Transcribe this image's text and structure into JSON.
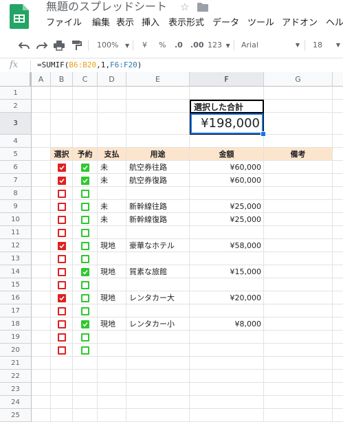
{
  "app": {
    "doc_title": "無題のスプレッドシート",
    "menu": [
      "ファイル",
      "編集",
      "表示",
      "挿入",
      "表示形式",
      "データ",
      "ツール",
      "アドオン",
      "ヘルプ"
    ]
  },
  "toolbar": {
    "zoom": "100%",
    "currency": "¥",
    "percent": "%",
    "dec_decrease": ".0",
    "dec_increase": ".00",
    "more_formats": "123",
    "font": "Arial",
    "font_size": "18"
  },
  "formula_bar": {
    "fx": "fx",
    "prefix": "=SUMIF(",
    "range1": "B6:B20",
    "mid": ",1,",
    "range2": "F6:F20",
    "suffix": ")"
  },
  "columns": [
    "A",
    "B",
    "C",
    "D",
    "E",
    "F",
    "G"
  ],
  "selected_column": "F",
  "selected_row": 3,
  "summary": {
    "label": "選択した合計",
    "value": "¥198,000"
  },
  "table_header": {
    "select": "選択",
    "reserve": "予約",
    "payment": "支払",
    "purpose": "用途",
    "amount": "金額",
    "note": "備考"
  },
  "rows": [
    {
      "row": 6,
      "select": true,
      "reserve": true,
      "payment": "未",
      "purpose": "航空券往路",
      "amount": "¥60,000"
    },
    {
      "row": 7,
      "select": true,
      "reserve": true,
      "payment": "未",
      "purpose": "航空券復路",
      "amount": "¥60,000"
    },
    {
      "row": 8,
      "select": false,
      "reserve": false,
      "payment": "",
      "purpose": "",
      "amount": ""
    },
    {
      "row": 9,
      "select": false,
      "reserve": false,
      "payment": "未",
      "purpose": "新幹線往路",
      "amount": "¥25,000"
    },
    {
      "row": 10,
      "select": false,
      "reserve": false,
      "payment": "未",
      "purpose": "新幹線復路",
      "amount": "¥25,000"
    },
    {
      "row": 11,
      "select": false,
      "reserve": false,
      "payment": "",
      "purpose": "",
      "amount": ""
    },
    {
      "row": 12,
      "select": true,
      "reserve": false,
      "payment": "現地",
      "purpose": "豪華なホテル",
      "amount": "¥58,000"
    },
    {
      "row": 13,
      "select": false,
      "reserve": false,
      "payment": "",
      "purpose": "",
      "amount": ""
    },
    {
      "row": 14,
      "select": false,
      "reserve": true,
      "payment": "現地",
      "purpose": "質素な旅館",
      "amount": "¥15,000"
    },
    {
      "row": 15,
      "select": false,
      "reserve": false,
      "payment": "",
      "purpose": "",
      "amount": ""
    },
    {
      "row": 16,
      "select": true,
      "reserve": false,
      "payment": "現地",
      "purpose": "レンタカー大",
      "amount": "¥20,000"
    },
    {
      "row": 17,
      "select": false,
      "reserve": false,
      "payment": "",
      "purpose": "",
      "amount": ""
    },
    {
      "row": 18,
      "select": false,
      "reserve": true,
      "payment": "現地",
      "purpose": "レンタカー小",
      "amount": "¥8,000"
    },
    {
      "row": 19,
      "select": false,
      "reserve": false,
      "payment": "",
      "purpose": "",
      "amount": ""
    },
    {
      "row": 20,
      "select": false,
      "reserve": false,
      "payment": "",
      "purpose": "",
      "amount": ""
    }
  ],
  "colors": {
    "select_checkbox": "#e02020",
    "reserve_checkbox": "#2ec82e",
    "header_fill": "#fce5cd",
    "selection": "#1a73e8"
  }
}
